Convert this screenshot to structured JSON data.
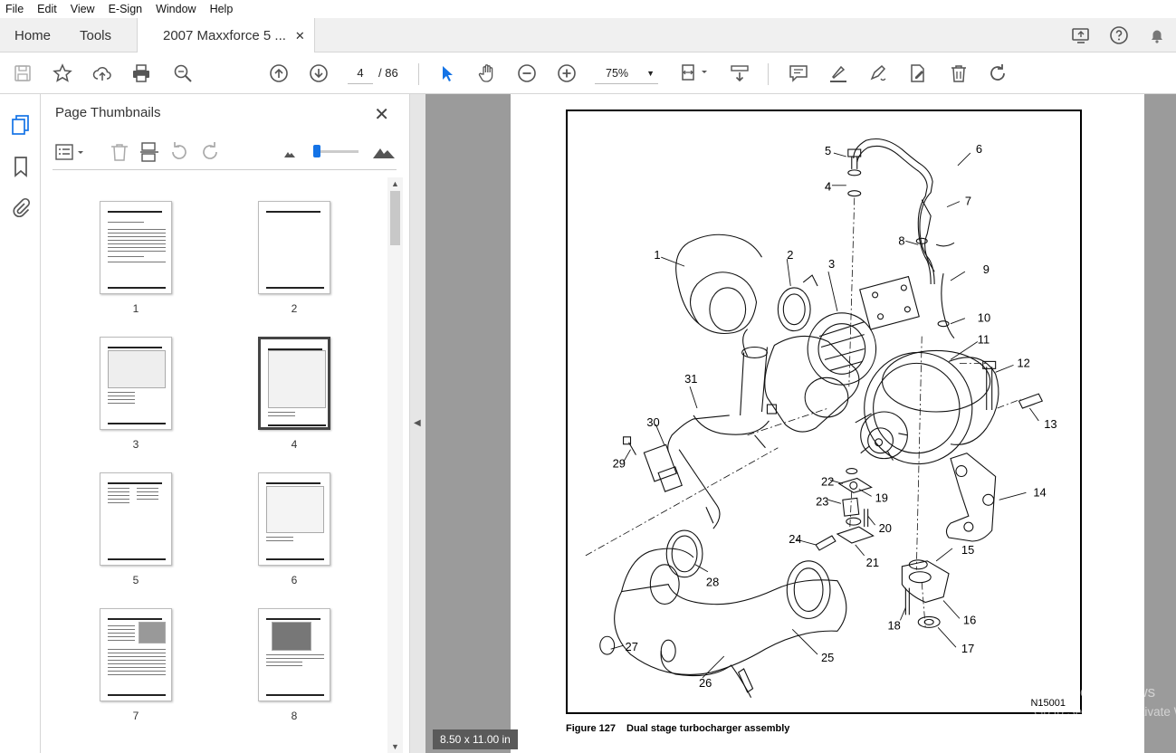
{
  "menu": [
    "File",
    "Edit",
    "View",
    "E-Sign",
    "Window",
    "Help"
  ],
  "tabs": {
    "home": "Home",
    "tools": "Tools",
    "document": "2007 Maxxforce 5 ...",
    "close": "✕"
  },
  "toolbar": {
    "current_page": "4",
    "total_pages": "/ 86",
    "zoom": "75%"
  },
  "panel": {
    "title": "Page Thumbnails",
    "close": "✕"
  },
  "thumbnails": [
    {
      "num": "1",
      "selected": false
    },
    {
      "num": "2",
      "selected": false
    },
    {
      "num": "3",
      "selected": false
    },
    {
      "num": "4",
      "selected": true
    },
    {
      "num": "5",
      "selected": false
    },
    {
      "num": "6",
      "selected": false
    },
    {
      "num": "7",
      "selected": false
    },
    {
      "num": "8",
      "selected": false
    }
  ],
  "page_size": "8.50 x 11.00 in",
  "figure": {
    "caption_label": "Figure 127",
    "caption_text": "Dual stage turbocharger assembly",
    "id": "N15001",
    "callouts": [
      "1",
      "2",
      "3",
      "4",
      "4",
      "5",
      "6",
      "7",
      "8",
      "9",
      "10",
      "11",
      "12",
      "13",
      "14",
      "15",
      "16",
      "17",
      "18",
      "19",
      "20",
      "21",
      "22",
      "23",
      "24",
      "25",
      "26",
      "27",
      "28",
      "29",
      "30",
      "31"
    ]
  },
  "watermark": {
    "line1": "Activate Windows",
    "line2": "Go to Settings to activate Windows."
  },
  "colors": {
    "accent": "#1473e6",
    "viewer_bg": "#9b9b9b"
  }
}
